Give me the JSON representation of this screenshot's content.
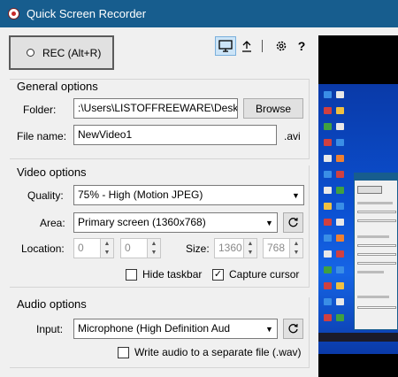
{
  "window": {
    "title": "Quick Screen Recorder"
  },
  "toolbar": {
    "rec_label": "REC (Alt+R)",
    "icons": [
      "monitor-icon",
      "upload-icon",
      "gear-icon",
      "help-icon"
    ],
    "help_label": "?"
  },
  "general": {
    "title": "General options",
    "folder_label": "Folder:",
    "folder_value": ":\\Users\\LISTOFFREEWARE\\Desktop",
    "browse_label": "Browse",
    "filename_label": "File name:",
    "filename_value": "NewVideo1",
    "extension": ".avi"
  },
  "video": {
    "title": "Video options",
    "quality_label": "Quality:",
    "quality_value": "75% - High (Motion JPEG)",
    "area_label": "Area:",
    "area_value": "Primary screen (1360x768)",
    "location_label": "Location:",
    "location_x": "0",
    "location_y": "0",
    "size_label": "Size:",
    "size_w": "1360",
    "size_h": "768",
    "hide_taskbar_label": "Hide taskbar",
    "hide_taskbar_checked": false,
    "capture_cursor_label": "Capture cursor",
    "capture_cursor_checked": true
  },
  "audio": {
    "title": "Audio options",
    "input_label": "Input:",
    "input_value": "Microphone (High Definition Aud",
    "separate_file_label": "Write audio to a separate file (.wav)",
    "separate_file_checked": false
  },
  "colors": {
    "titlebar": "#175d8e",
    "accent": "#cce4f7"
  }
}
